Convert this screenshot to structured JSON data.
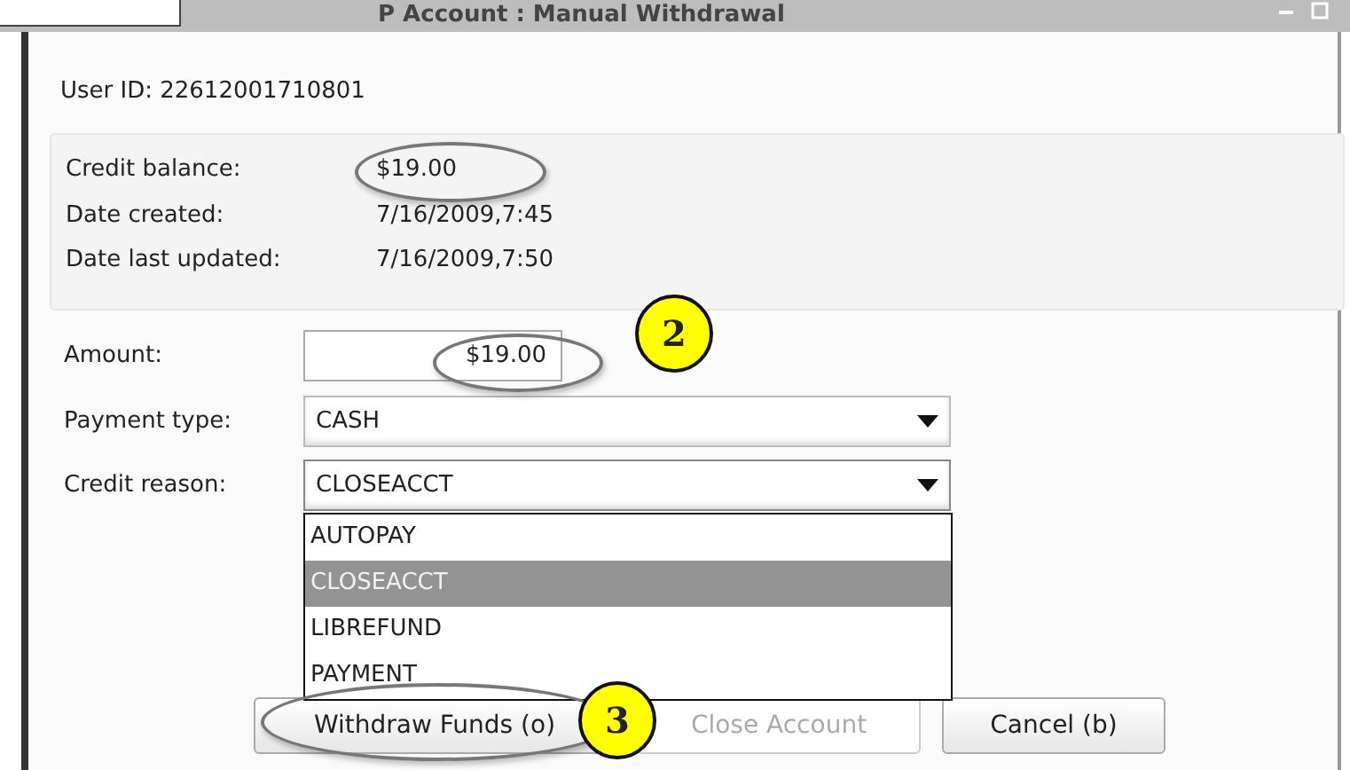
{
  "window": {
    "title": "P Account : Manual Withdrawal"
  },
  "user_id": "User ID: 22612001710801",
  "info": [
    {
      "label": "Credit balance:",
      "value": "$19.00",
      "circled": true
    },
    {
      "label": "Date created:",
      "value": "7/16/2009,7:45",
      "circled": false
    },
    {
      "label": "Date last updated:",
      "value": "7/16/2009,7:50",
      "circled": false
    }
  ],
  "form": {
    "amount": {
      "label": "Amount:",
      "value": "$19.00",
      "circled": true
    },
    "payment_type": {
      "label": "Payment type:",
      "value": "CASH"
    },
    "credit_reason": {
      "label": "Credit reason:",
      "value": "CLOSEACCT",
      "expanded": true,
      "options": [
        {
          "label": "AUTOPAY",
          "selected": false
        },
        {
          "label": "CLOSEACCT",
          "selected": true
        },
        {
          "label": "LIBREFUND",
          "selected": false
        },
        {
          "label": "PAYMENT",
          "selected": false
        }
      ]
    }
  },
  "buttons": [
    {
      "label": "Withdraw Funds (o)",
      "disabled": false,
      "circled": true
    },
    {
      "label": "Close Account",
      "disabled": true,
      "circled": false
    },
    {
      "label": "Cancel (b)",
      "disabled": false,
      "circled": false
    }
  ],
  "callouts": [
    {
      "label": "2"
    },
    {
      "label": "3"
    }
  ]
}
